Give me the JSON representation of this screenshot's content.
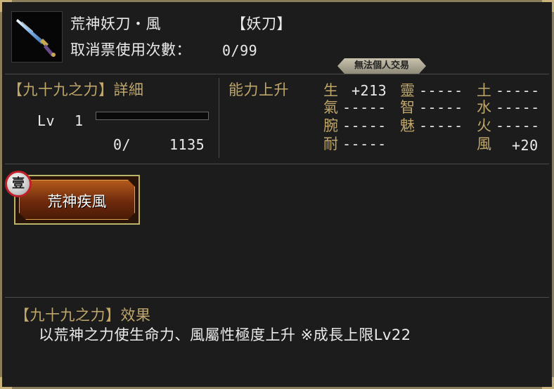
{
  "item": {
    "name": "荒神妖刀・風",
    "category": "【妖刀】",
    "ticket_label": "取消票使用次數：",
    "ticket_count": "0/99",
    "trade_badge": "無法個人交易"
  },
  "detail": {
    "title": "【九十九之力】詳細",
    "lv_label": "Lv",
    "lv_value": "1",
    "exp_current": "0/",
    "exp_max": "1135",
    "exp_progress": 0
  },
  "stats": {
    "title": "能力上升",
    "col1": [
      {
        "name": "生",
        "value": "+213"
      },
      {
        "name": "氣",
        "value": "-----"
      },
      {
        "name": "腕",
        "value": "-----"
      },
      {
        "name": "耐",
        "value": "-----"
      }
    ],
    "col2": [
      {
        "name": "靈",
        "value": "-----"
      },
      {
        "name": "智",
        "value": "-----"
      },
      {
        "name": "魅",
        "value": "-----"
      }
    ],
    "col3": [
      {
        "name": "土",
        "value": "-----"
      },
      {
        "name": "水",
        "value": "-----"
      },
      {
        "name": "火",
        "value": "-----"
      },
      {
        "name": "風",
        "value": "+20"
      }
    ]
  },
  "skill": {
    "rank": "壹",
    "label": "荒神疾風"
  },
  "effect": {
    "title": "【九十九之力】效果",
    "text": "以荒神之力使生命力、風屬性極度上升 ※成長上限Lv22"
  },
  "colors": {
    "gold": "#bfa66a",
    "panel": "#1c1c1c",
    "frame": "#8a7d5a"
  }
}
